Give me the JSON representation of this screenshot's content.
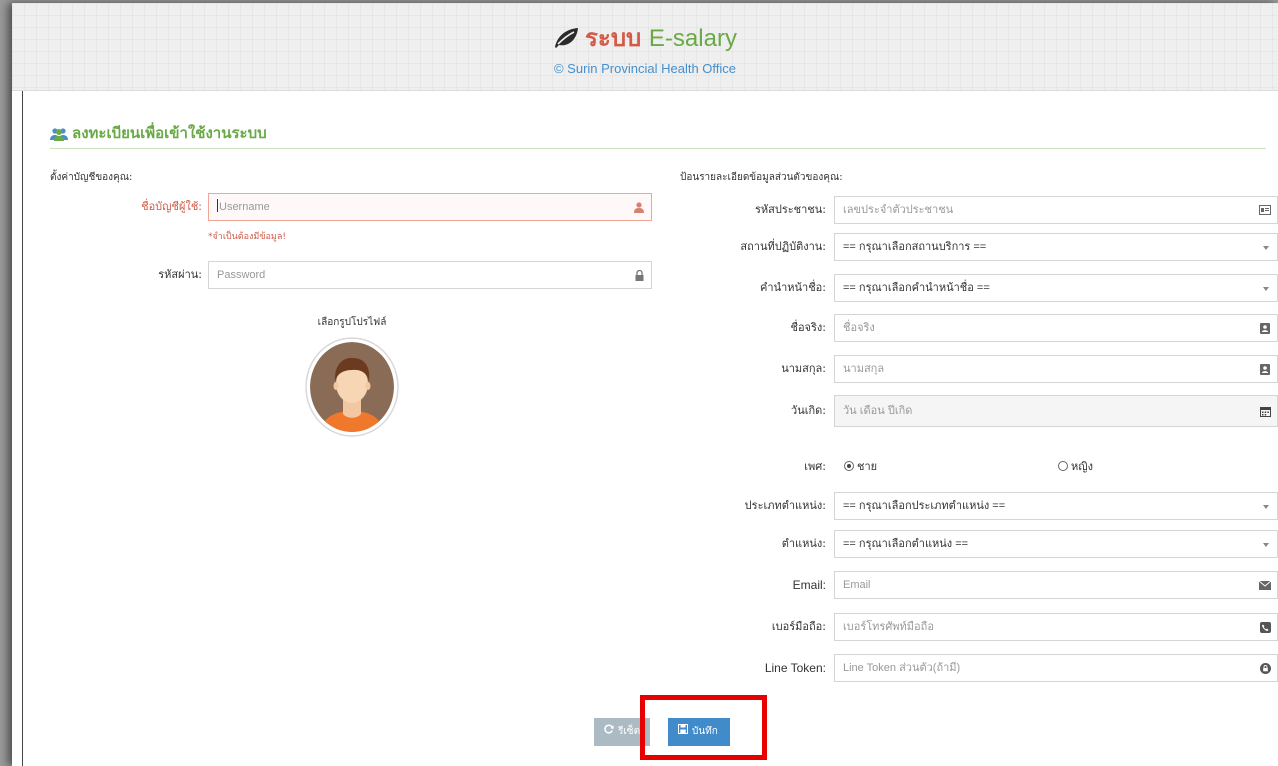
{
  "header": {
    "brand_thai": "ระบบ",
    "brand_eng": "E-salary",
    "subtitle": "© Surin Provincial Health Office"
  },
  "section": {
    "title": "ลงทะเบียนเพื่อเข้าใช้งานระบบ"
  },
  "account": {
    "heading": "ตั้งค่าบัญชีของคุณ:",
    "username_label": "ชื่อบัญชีผู้ใช้:",
    "username_placeholder": "Username",
    "username_error": "*จำเป็นต้องมีข้อมูล!",
    "password_label": "รหัสผ่าน:",
    "password_placeholder": "Password",
    "avatar_label": "เลือกรูปโปรไฟล์"
  },
  "personal": {
    "heading": "ป้อนรายละเอียดข้อมูลส่วนตัวของคุณ:",
    "fields": [
      {
        "label": "รหัสประชาชน:",
        "value": "เลขประจำตัวประชาชน",
        "kind": "text",
        "icon": "id-card-icon"
      },
      {
        "label": "สถานที่ปฏิบัติงาน:",
        "value": "== กรุณาเลือกสถานบริการ ==",
        "kind": "select"
      },
      {
        "label": "คำนำหน้าชื่อ:",
        "value": "== กรุณาเลือกคำนำหน้าชื่อ ==",
        "kind": "select"
      },
      {
        "label": "ชื่อจริง:",
        "value": "ชื่อจริง",
        "kind": "text",
        "icon": "contact-book-icon"
      },
      {
        "label": "นามสกุล:",
        "value": "นามสกุล",
        "kind": "text",
        "icon": "contact-book-icon"
      },
      {
        "label": "วันเกิด:",
        "value": "วัน เดือน ปีเกิด",
        "kind": "disabled",
        "icon": "calendar-icon"
      }
    ],
    "gender_label": "เพศ:",
    "gender_male": "ชาย",
    "gender_female": "หญิง",
    "gender_selected": "male",
    "fields2": [
      {
        "label": "ประเภทตำแหน่ง:",
        "value": "== กรุณาเลือกประเภทตำแหน่ง ==",
        "kind": "select"
      },
      {
        "label": "ตำแหน่ง:",
        "value": "== กรุณาเลือกตำแหน่ง ==",
        "kind": "select"
      },
      {
        "label": "Email:",
        "value": "Email",
        "kind": "text",
        "icon": "envelope-icon"
      },
      {
        "label": "เบอร์มือถือ:",
        "value": "เบอร์โทรศัพท์มือถือ",
        "kind": "text",
        "icon": "phone-icon"
      },
      {
        "label": "Line Token:",
        "value": "Line Token ส่วนตัว(ถ้ามี)",
        "kind": "text",
        "icon": "lock-circle-icon"
      }
    ]
  },
  "buttons": {
    "reset": "รีเซ็ต",
    "save": "บันทึก"
  },
  "colors": {
    "accent_green": "#69aa46",
    "accent_red": "#d15b47",
    "primary_blue": "#428bca",
    "highlight": "#e60000"
  }
}
